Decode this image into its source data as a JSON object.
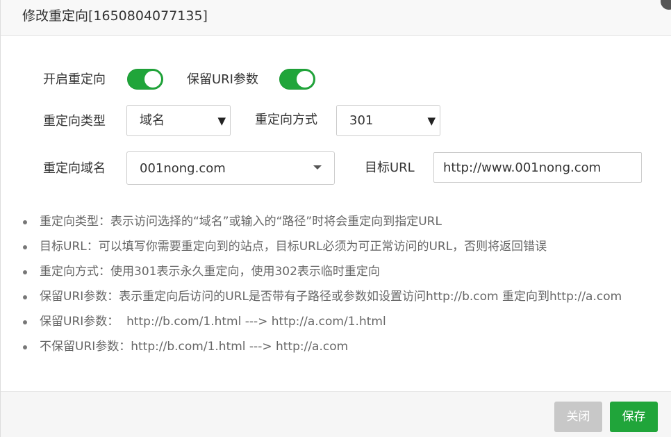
{
  "dialog": {
    "title": "修改重定向[1650804077135]"
  },
  "form": {
    "enable_redirect_label": "开启重定向",
    "enable_redirect_on": true,
    "keep_uri_label": "保留URI参数",
    "keep_uri_on": true,
    "redirect_type_label": "重定向类型",
    "redirect_type_value": "域名",
    "redirect_method_label": "重定向方式",
    "redirect_method_value": "301",
    "redirect_domain_label": "重定向域名",
    "redirect_domain_value": "001nong.com",
    "target_url_label": "目标URL",
    "target_url_value": "http://www.001nong.com"
  },
  "tips": [
    "重定向类型：表示访问选择的“域名”或输入的“路径”时将会重定向到指定URL",
    "目标URL：可以填写你需要重定向到的站点，目标URL必须为可正常访问的URL，否则将返回错误",
    "重定向方式：使用301表示永久重定向，使用302表示临时重定向",
    "保留URI参数：表示重定向后访问的URL是否带有子路径或参数如设置访问http://b.com 重定向到http://a.com",
    "保留URI参数：  http://b.com/1.html ---> http://a.com/1.html",
    "不保留URI参数：http://b.com/1.html ---> http://a.com"
  ],
  "footer": {
    "close_label": "关闭",
    "save_label": "保存"
  },
  "colors": {
    "accent": "#20a53a",
    "disabled_button": "#c8c8c8"
  }
}
